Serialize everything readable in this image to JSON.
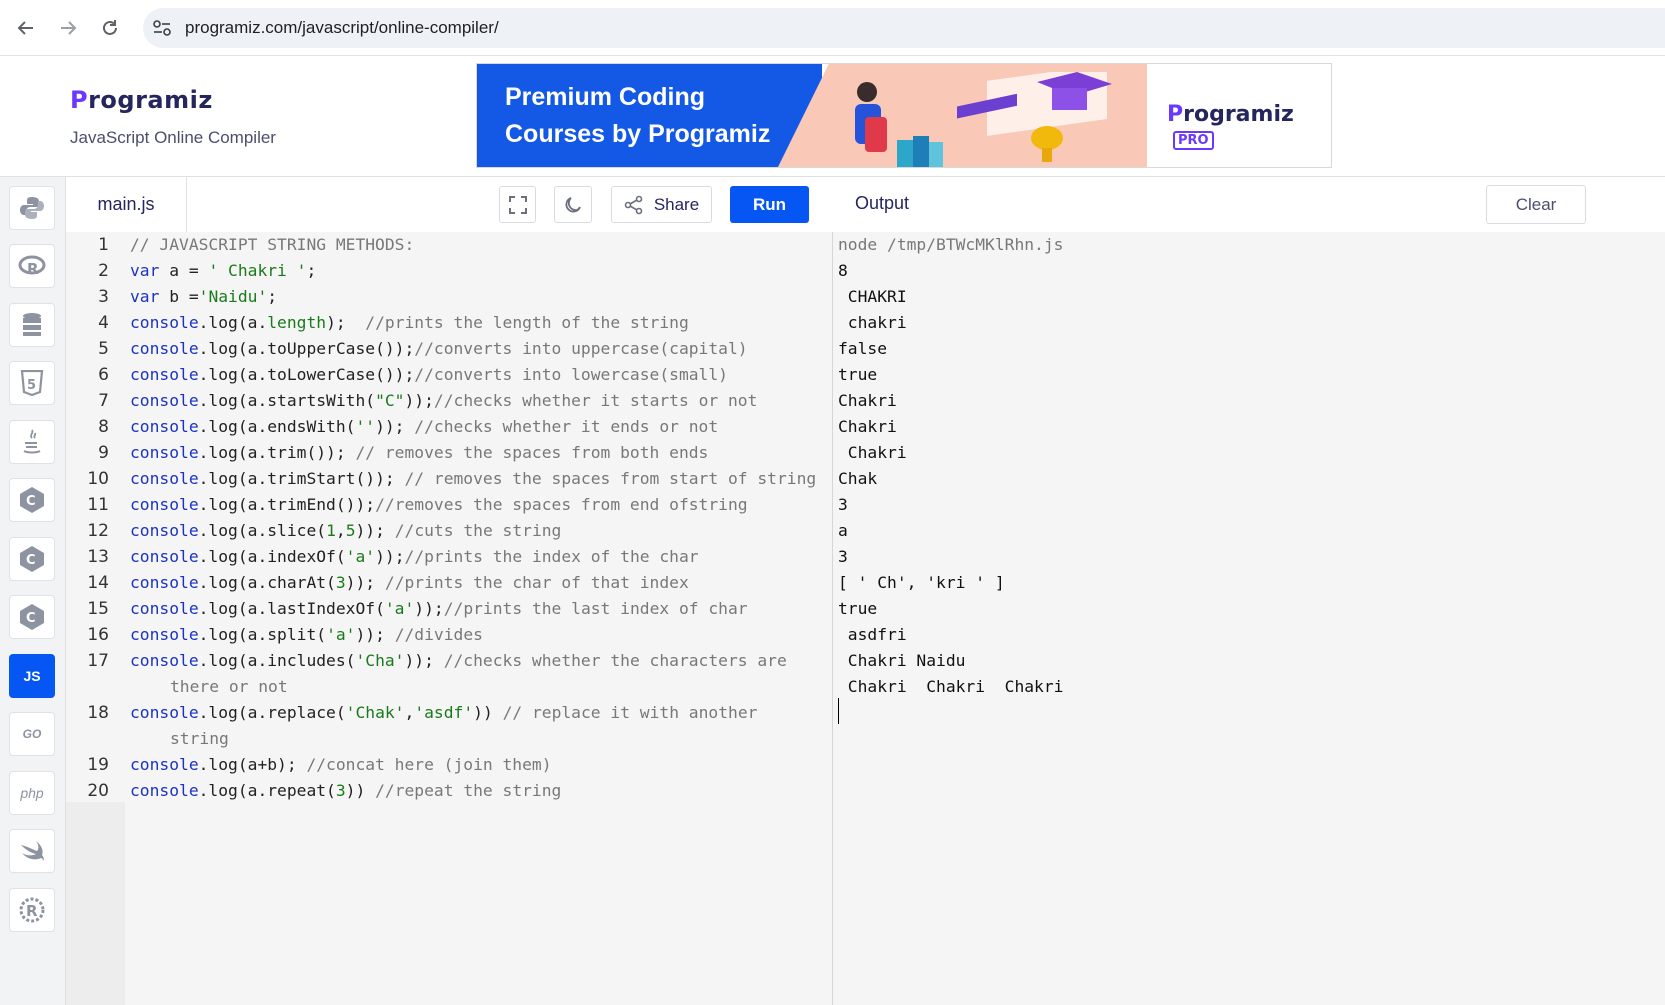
{
  "browser": {
    "url": "programiz.com/javascript/online-compiler/",
    "back_icon": "arrow-left-icon",
    "forward_icon": "arrow-right-icon",
    "reload_icon": "reload-icon"
  },
  "header": {
    "logo_initial": "P",
    "logo_rest": "rogramiz",
    "subtitle": "JavaScript Online Compiler",
    "banner_line1": "Premium Coding",
    "banner_line2": "Courses by Programiz",
    "banner_logo_initial": "P",
    "banner_logo_rest": "rogramiz",
    "banner_badge": "PRO"
  },
  "languages": [
    {
      "name": "python",
      "icon": "python-icon",
      "label": "",
      "active": false
    },
    {
      "name": "r",
      "icon": "r-icon",
      "label": "R",
      "active": false
    },
    {
      "name": "sql",
      "icon": "database-icon",
      "label": "",
      "active": false
    },
    {
      "name": "html",
      "icon": "html5-icon",
      "label": "5",
      "active": false
    },
    {
      "name": "java",
      "icon": "java-icon",
      "label": "",
      "active": false
    },
    {
      "name": "c",
      "icon": "c-icon",
      "label": "C",
      "active": false
    },
    {
      "name": "cpp",
      "icon": "cpp-icon",
      "label": "C",
      "active": false
    },
    {
      "name": "csharp",
      "icon": "csharp-icon",
      "label": "C",
      "active": false
    },
    {
      "name": "javascript",
      "icon": "js-icon",
      "label": "JS",
      "active": true
    },
    {
      "name": "go",
      "icon": "go-icon",
      "label": "GO",
      "active": false
    },
    {
      "name": "php",
      "icon": "php-icon",
      "label": "php",
      "active": false
    },
    {
      "name": "swift",
      "icon": "swift-icon",
      "label": "",
      "active": false
    },
    {
      "name": "rust",
      "icon": "rust-icon",
      "label": "R",
      "active": false
    }
  ],
  "editor": {
    "file_name": "main.js",
    "share_label": "Share",
    "run_label": "Run",
    "active_line": 8
  },
  "output": {
    "title": "Output",
    "clear_label": "Clear",
    "lines": [
      "node /tmp/BTWcMKlRhn.js",
      "8",
      " CHAKRI ",
      " chakri ",
      "false",
      "true",
      "Chakri",
      "Chakri ",
      " Chakri",
      "Chak",
      "3",
      "a",
      "3",
      "[ ' Ch', 'kri ' ]",
      "true",
      " asdfri ",
      " Chakri Naidu",
      " Chakri  Chakri  Chakri "
    ]
  },
  "code": {
    "line1": "// JAVASCRIPT STRING METHODS:",
    "line2_str": "' Chakri '",
    "line3_str": "'Naidu'",
    "line4_com": "//prints the length of the string",
    "line5_com": "//converts into uppercase(capital)",
    "line6_com": "//converts into lowercase(small)",
    "line7_str": "\"C\"",
    "line7_com": "//checks whether it starts or not",
    "line8_str": "''",
    "line8_com": "//checks whether it ends or not",
    "line9_com": "// removes the spaces from both ends",
    "line10_com": "// removes the spaces from start of string",
    "line11_com": "//removes the spaces from end ofstring",
    "line12_com": "//cuts the string",
    "line13_com": "//prints the index of the char",
    "line14_com": "//prints the char of that index",
    "line15_com": "//prints the last index of char",
    "line16_com": "//divides",
    "line17_com": "//checks whether the characters are",
    "line17_cont": "there or not",
    "line18_com": "// replace it with another",
    "line18_cont": "string",
    "line19_com": "//concat here (join them)",
    "line20_com": "//repeat the string"
  }
}
